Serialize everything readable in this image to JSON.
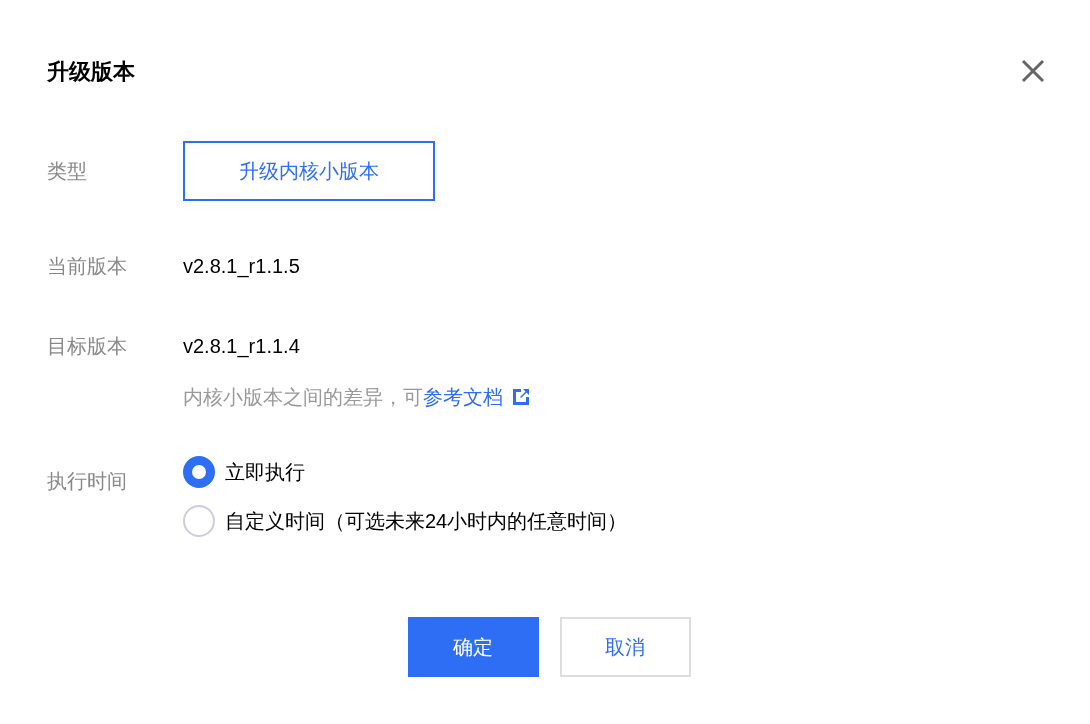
{
  "dialog": {
    "title": "升级版本",
    "type": {
      "label": "类型",
      "options": [
        {
          "label": "升级内核小版本",
          "selected": true
        }
      ]
    },
    "current_version": {
      "label": "当前版本",
      "value": "v2.8.1_r1.1.5"
    },
    "target_version": {
      "label": "目标版本",
      "value": "v2.8.1_r1.1.4",
      "hint": "内核小版本之间的差异，可",
      "link": "参考文档"
    },
    "execution_time": {
      "label": "执行时间",
      "options": [
        {
          "label": "立即执行",
          "selected": true
        },
        {
          "label": "自定义时间（可选未来24小时内的任意时间）",
          "selected": false
        }
      ]
    },
    "buttons": [
      {
        "label": "确定",
        "kind": "primary"
      },
      {
        "label": "取消",
        "kind": "secondary"
      }
    ]
  }
}
